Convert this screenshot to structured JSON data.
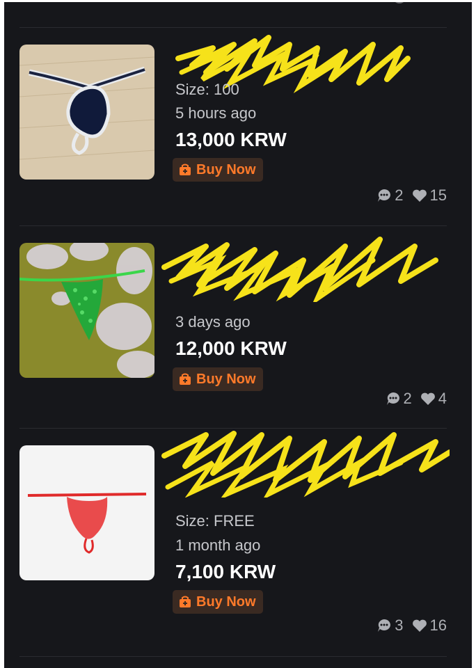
{
  "listings": [
    {
      "size": "Size: 100",
      "time": "5 hours ago",
      "price": "13,000 KRW",
      "buy_label": "Buy Now",
      "comments": "2",
      "likes": "15"
    },
    {
      "time": "3 days ago",
      "price": "12,000 KRW",
      "buy_label": "Buy Now",
      "comments": "2",
      "likes": "4"
    },
    {
      "size": "Size: FREE",
      "time": "1 month ago",
      "price": "7,100 KRW",
      "buy_label": "Buy Now",
      "comments": "3",
      "likes": "16"
    }
  ],
  "colors": {
    "background": "#16171b",
    "accent": "#ff7a2a",
    "redaction": "#f6e21a"
  },
  "icons": [
    "chat-bubble-icon",
    "heart-icon",
    "buy-now-icon"
  ]
}
